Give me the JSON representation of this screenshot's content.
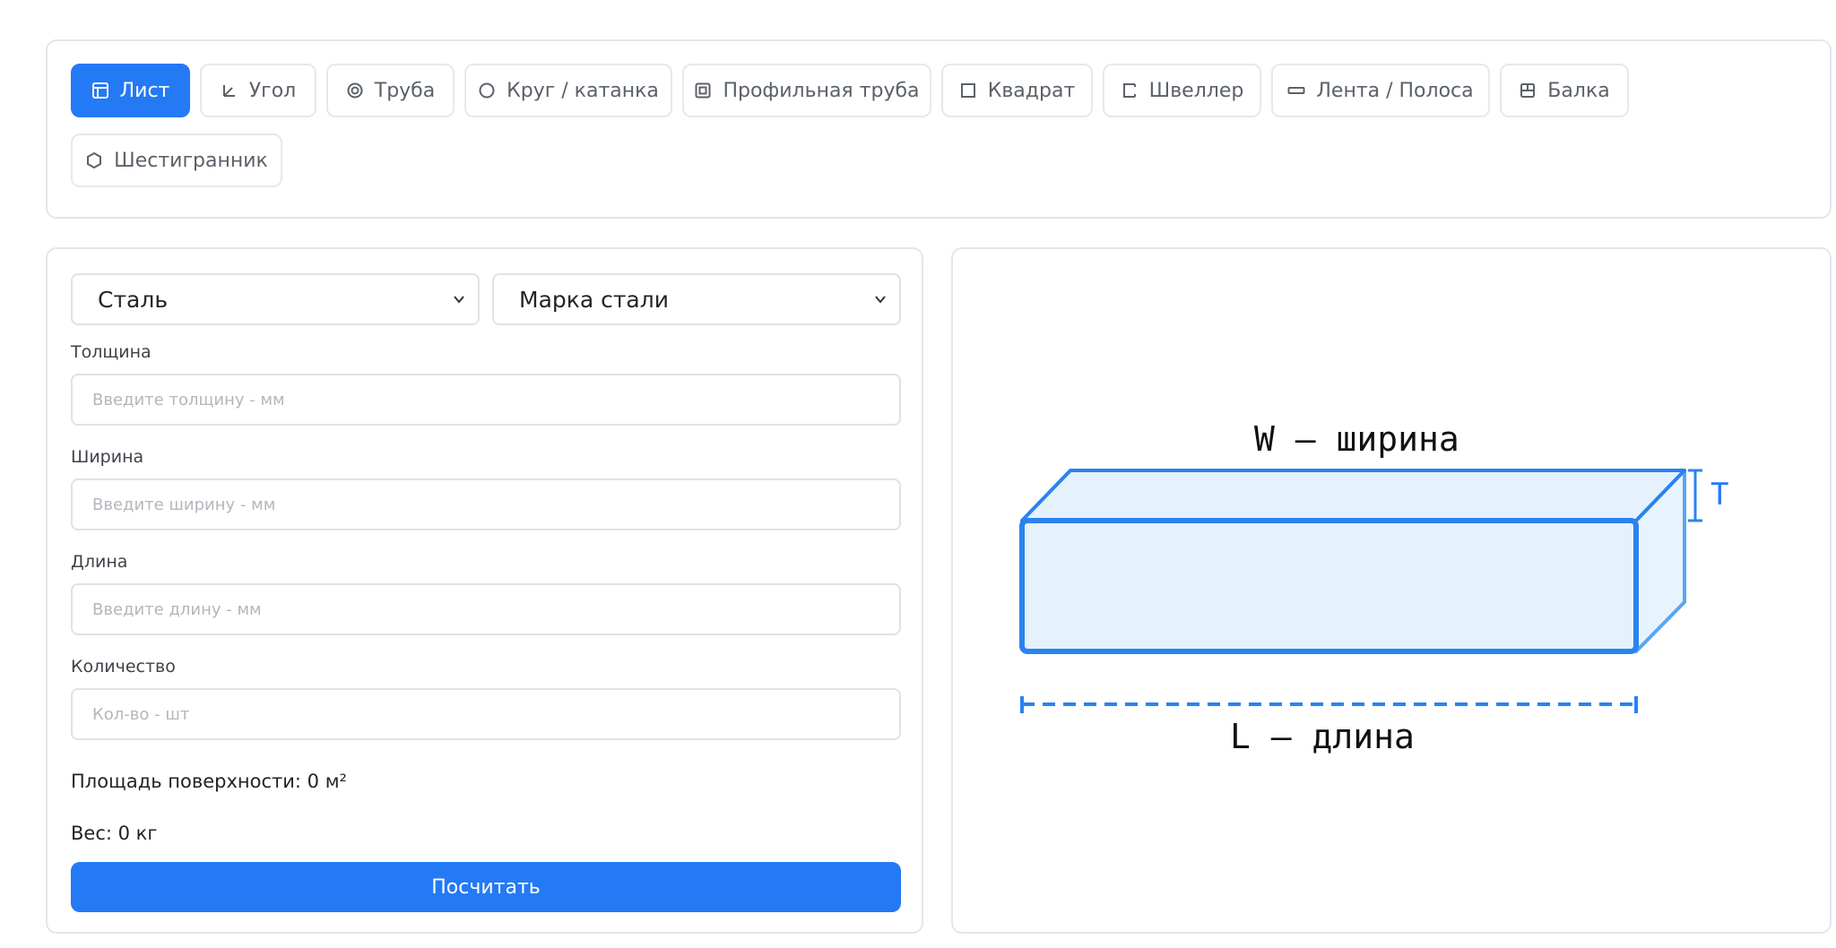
{
  "colors": {
    "accent": "#2479f5",
    "border": "#e4e6ea",
    "diagram_fill": "#e5f2fd",
    "diagram_stroke": "#2a83ef"
  },
  "tabs": [
    {
      "label": "Лист",
      "icon": "sheet-icon",
      "active": true
    },
    {
      "label": "Угол",
      "icon": "angle-icon",
      "active": false
    },
    {
      "label": "Труба",
      "icon": "pipe-icon",
      "active": false
    },
    {
      "label": "Круг / катанка",
      "icon": "circle-icon",
      "active": false
    },
    {
      "label": "Профильная труба",
      "icon": "profile-pipe-icon",
      "active": false
    },
    {
      "label": "Квадрат",
      "icon": "square-icon",
      "active": false
    },
    {
      "label": "Швеллер",
      "icon": "channel-icon",
      "active": false
    },
    {
      "label": "Лента / Полоса",
      "icon": "strip-icon",
      "active": false
    },
    {
      "label": "Балка",
      "icon": "beam-icon",
      "active": false
    },
    {
      "label": "Шестигранник",
      "icon": "hexagon-icon",
      "active": false
    }
  ],
  "form": {
    "material_select": {
      "value": "Сталь",
      "icon": "chevron-down-icon"
    },
    "grade_select": {
      "value": "Марка стали",
      "icon": "chevron-down-icon"
    },
    "thickness": {
      "label": "Толщина",
      "placeholder": "Введите толщину - мм",
      "value": ""
    },
    "width": {
      "label": "Ширина",
      "placeholder": "Введите ширину - мм",
      "value": ""
    },
    "length": {
      "label": "Длина",
      "placeholder": "Введите длину - мм",
      "value": ""
    },
    "quantity": {
      "label": "Количество",
      "placeholder": "Кол-во - шт",
      "value": ""
    },
    "surface_area": "Площадь поверхности: 0 м²",
    "weight": "Вес: 0 кг",
    "calculate_label": "Посчитать"
  },
  "diagram": {
    "width_label": "W — ширина",
    "length_label": "L — длина",
    "thickness_label": "T"
  }
}
